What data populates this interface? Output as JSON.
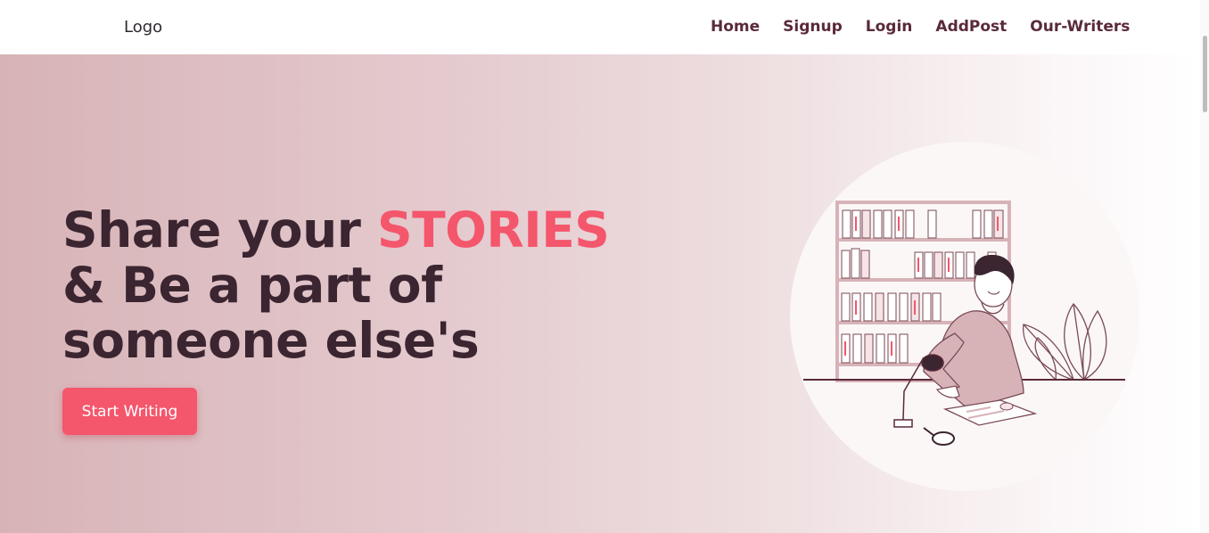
{
  "navbar": {
    "logo": "Logo",
    "links": [
      "Home",
      "Signup",
      "Login",
      "AddPost",
      "Our-Writers"
    ]
  },
  "hero": {
    "headline_part1": "Share your ",
    "headline_accent": "STORIES",
    "headline_part2": " & Be a part of someone else's",
    "cta_label": "Start Writing"
  },
  "colors": {
    "accent": "#f4566c",
    "nav_text": "#5a2a3a",
    "headline": "#3a2530",
    "hero_gradient_start": "#d7b3b7"
  },
  "illustration": {
    "icon": "reading-person-bookshelf-illustration"
  }
}
